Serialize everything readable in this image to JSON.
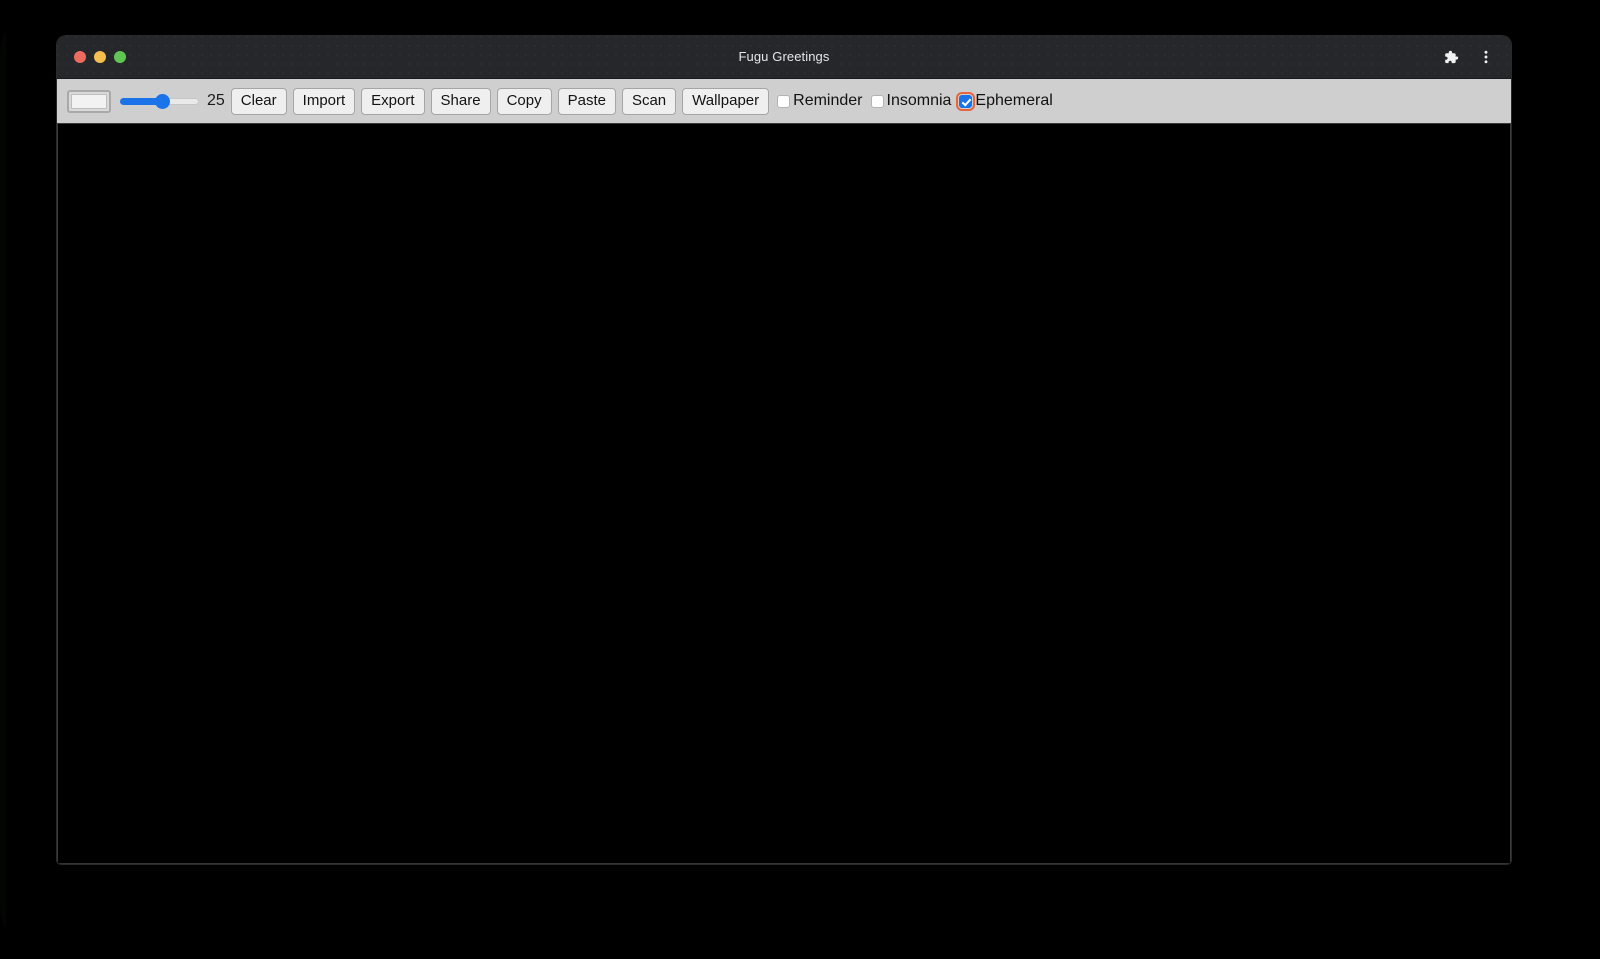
{
  "window": {
    "title": "Fugu Greetings",
    "traffic_lights": [
      {
        "name": "close",
        "color": "#ed6a5e"
      },
      {
        "name": "minimize",
        "color": "#f4bf4f"
      },
      {
        "name": "maximize",
        "color": "#61c554"
      }
    ],
    "titlebar_actions": [
      {
        "icon": "extensions-puzzle-icon"
      },
      {
        "icon": "more-vertical-menu-icon"
      }
    ]
  },
  "toolbar": {
    "color_picker": {
      "icon": "color-swatch-icon",
      "value": "#f2f2f2"
    },
    "line_width": {
      "value": "25",
      "min": "1",
      "max": "50",
      "percent": 50,
      "accent_color": "#1a73e8"
    },
    "buttons": [
      {
        "label": "Clear"
      },
      {
        "label": "Import"
      },
      {
        "label": "Export"
      },
      {
        "label": "Share"
      },
      {
        "label": "Copy"
      },
      {
        "label": "Paste"
      },
      {
        "label": "Scan"
      },
      {
        "label": "Wallpaper"
      }
    ],
    "checkboxes": [
      {
        "label": "Reminder",
        "checked": false,
        "focused": false
      },
      {
        "label": "Insomnia",
        "checked": false,
        "focused": false
      },
      {
        "label": "Ephemeral",
        "checked": true,
        "focused": true
      }
    ]
  },
  "canvas": {
    "background_color": "#000000"
  }
}
